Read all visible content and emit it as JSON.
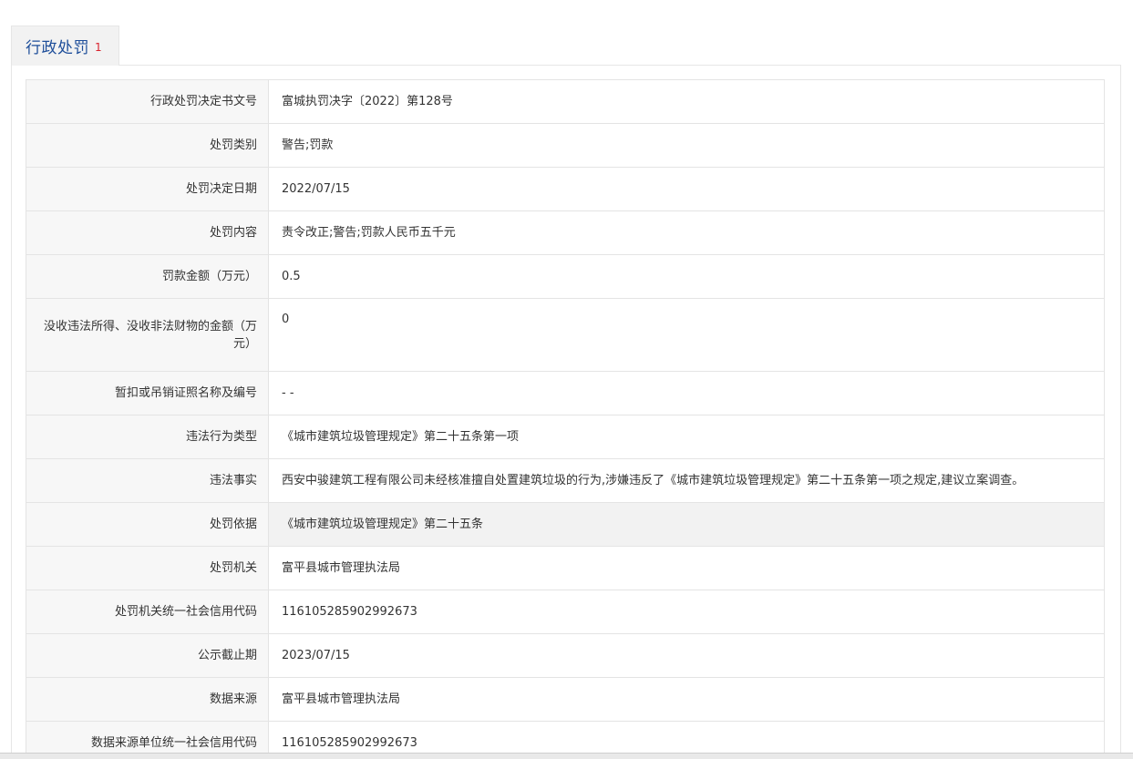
{
  "tab": {
    "label": "行政处罚",
    "count": "1"
  },
  "rows": [
    {
      "label": "行政处罚决定书文号",
      "value": "富城执罚决字〔2022〕第128号"
    },
    {
      "label": "处罚类别",
      "value": "警告;罚款"
    },
    {
      "label": "处罚决定日期",
      "value": "2022/07/15"
    },
    {
      "label": "处罚内容",
      "value": "责令改正;警告;罚款人民币五千元"
    },
    {
      "label": "罚款金额（万元）",
      "value": "0.5"
    },
    {
      "label": "没收违法所得、没收非法财物的金额（万元）",
      "value": "0"
    },
    {
      "label": "暂扣或吊销证照名称及编号",
      "value": "- -"
    },
    {
      "label": "违法行为类型",
      "value": "《城市建筑垃圾管理规定》第二十五条第一项"
    },
    {
      "label": "违法事实",
      "value": "西安中骏建筑工程有限公司未经核准擅自处置建筑垃圾的行为,涉嫌违反了《城市建筑垃圾管理规定》第二十五条第一项之规定,建议立案调查。"
    },
    {
      "label": "处罚依据",
      "value": "《城市建筑垃圾管理规定》第二十五条"
    },
    {
      "label": "处罚机关",
      "value": "富平县城市管理执法局"
    },
    {
      "label": "处罚机关统一社会信用代码",
      "value": "116105285902992673"
    },
    {
      "label": "公示截止期",
      "value": "2023/07/15"
    },
    {
      "label": "数据来源",
      "value": "富平县城市管理执法局"
    },
    {
      "label": "数据来源单位统一社会信用代码",
      "value": "116105285902992673"
    }
  ]
}
